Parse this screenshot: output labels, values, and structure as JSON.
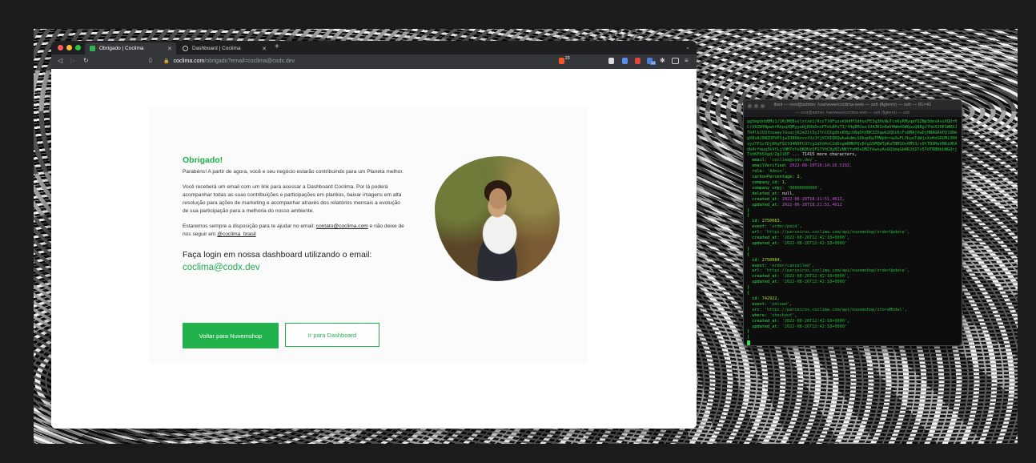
{
  "browser": {
    "tabs": [
      {
        "title": "Obrigado | Coclima",
        "active": true
      },
      {
        "title": "Dashboard | Coclima",
        "active": false
      }
    ],
    "new_tab": "+",
    "url_host": "coclima.com",
    "url_path": "/obrigado?email=coclima@codx.dev",
    "brave_badge": "23",
    "ext_badge": "14"
  },
  "page": {
    "heading": "Obrigado!",
    "para1": "Parabéns! A partir de agora, você e seu negócio estarão contribuindo para um Planeta melhor.",
    "para2": "Você receberá um email com um link para acessar a Dashboard Coclima. Por lá poderá acompanhar todas as suas contribuições e participações em plantios, baixar imagens em alta resolução para ações de marketing e acompanhar através dos relatórios mensais a evolução de sua participação para a melhoria do nosso ambiente.",
    "para3_before": "Estaremos sempre a disposição para te ajudar no email: ",
    "contact_email": "contato@coclima.com",
    "para3_middle": " e não deixe de nos seguir em ",
    "instagram": "@coclima_brasil",
    "login_title": "Faça login em nossa dashboard utilizando o email:",
    "login_email": "coclima@codx.dev",
    "btn_primary": "Voltar para Nuvemshop",
    "btn_secondary": "Ir para Dashboard"
  },
  "colors": {
    "accent": "#22b24c"
  },
  "terminal": {
    "title": "lbeit — root@admin: /var/www/coclima-web — ssh (figterm) — ssh — 81×41",
    "subtitle": "— root@admin: /var/www/coclima-web — ssh (figterm) — ssh",
    "blob": "ggSmpdnbBMz1/1KcM6Bvvlxtxe1/KccTl6Fuzsk9nHfSdhuxFE3q3HvNuTcsKyRMyqaYQZNp3dexAvsXQUrHCrV6ZWYNpwhfRhpqXQMyyaNjEObDnsPTdtAPoT3/fHqEMJaxlU4JKIn6mYHWm4OWQuuQ8BgJ7hbXJ0ESWRXJTb4lbJQ3fnoaaylGswcjK2m31t9yJYnlQ1gdhxKHgcbNqDhVBK3ZXqwb2QDiRcFx8MAjUwDjHNAGRkPQl8RmgV8xAJ8NZUPVPSjwIO8OAsvvtVzJfjVC8IQRQwkwkdmLS0kqdGpTMWp8rnwXwFLYbyeTqWjsXzHoGRUMi30HxyzTP1zfDjRKqFQ2lQ4N9PCU7cg1dVd4vC2d6ngmRMKPQvBfgS5MQWTpKaTBM1Ov6MV3/x0tTBXMaVBRi0KAdb4rfmuq3kVfLjlHH7nYnQK8UzQFS7YhC8yBZzNKYfoHOvQMZfkwnyAsGQSmqGb4RJd1Tv5TdTBBNkbNGQrjTshKFb5Xgd/ZgJiEP",
    "more": " ... 71415 more characters,",
    "lines": [
      [
        {
          "t": "  email: ",
          "c": "key"
        },
        {
          "t": "'coclima@codx.dev'",
          "c": "str"
        },
        {
          "t": ",",
          "c": "key"
        }
      ],
      [
        {
          "t": "  emailVerified: ",
          "c": "key"
        },
        {
          "t": "2022-08-10T16:14:20.519Z",
          "c": "date"
        },
        {
          "t": ",",
          "c": "key"
        }
      ],
      [
        {
          "t": "  role: ",
          "c": "key"
        },
        {
          "t": "'Admin'",
          "c": "str"
        },
        {
          "t": ",",
          "c": "key"
        }
      ],
      [
        {
          "t": "  carbonPercentage: ",
          "c": "key"
        },
        {
          "t": "2",
          "c": "num"
        },
        {
          "t": ",",
          "c": "key"
        }
      ],
      [
        {
          "t": "  company_id: ",
          "c": "key"
        },
        {
          "t": "1",
          "c": "num"
        },
        {
          "t": ",",
          "c": "key"
        }
      ],
      [
        {
          "t": "  company_cnpj: ",
          "c": "key"
        },
        {
          "t": "'00000000000'",
          "c": "str"
        },
        {
          "t": ",",
          "c": "key"
        }
      ],
      [
        {
          "t": "  deleted_at: ",
          "c": "key"
        },
        {
          "t": "null",
          "c": "white"
        },
        {
          "t": ",",
          "c": "key"
        }
      ],
      [
        {
          "t": "  created_at: ",
          "c": "key"
        },
        {
          "t": "2022-06-28T18:21:51.461Z",
          "c": "date"
        },
        {
          "t": ",",
          "c": "key"
        }
      ],
      [
        {
          "t": "  updated_at: ",
          "c": "key"
        },
        {
          "t": "2022-06-28T18:21:51.461Z",
          "c": "date"
        }
      ],
      [
        {
          "t": "}",
          "c": "key"
        }
      ],
      [
        {
          "t": "{",
          "c": "key"
        }
      ],
      [
        {
          "t": "  id: ",
          "c": "key"
        },
        {
          "t": "2750083",
          "c": "num"
        },
        {
          "t": ",",
          "c": "key"
        }
      ],
      [
        {
          "t": "  event: ",
          "c": "key"
        },
        {
          "t": "'order/paid'",
          "c": "str"
        },
        {
          "t": ",",
          "c": "key"
        }
      ],
      [
        {
          "t": "  url: ",
          "c": "key"
        },
        {
          "t": "'https://parceiros.coclima.com/api/nuvemshop/orderUpdate'",
          "c": "str"
        },
        {
          "t": ",",
          "c": "key"
        }
      ],
      [
        {
          "t": "  created_at: ",
          "c": "key"
        },
        {
          "t": "'2022-08-26T12:42:18+0000'",
          "c": "str"
        },
        {
          "t": ",",
          "c": "key"
        }
      ],
      [
        {
          "t": "  updated_at: ",
          "c": "key"
        },
        {
          "t": "'2022-08-26T12:42:18+0000'",
          "c": "str"
        }
      ],
      [
        {
          "t": "}",
          "c": "key"
        }
      ],
      [
        {
          "t": "{",
          "c": "key"
        }
      ],
      [
        {
          "t": "  id: ",
          "c": "key"
        },
        {
          "t": "2750084",
          "c": "num"
        },
        {
          "t": ",",
          "c": "key"
        }
      ],
      [
        {
          "t": "  event: ",
          "c": "key"
        },
        {
          "t": "'order/cancelled'",
          "c": "str"
        },
        {
          "t": ",",
          "c": "key"
        }
      ],
      [
        {
          "t": "  url: ",
          "c": "key"
        },
        {
          "t": "'https://parceiros.coclima.com/api/nuvemshop/orderUpdate'",
          "c": "str"
        },
        {
          "t": ",",
          "c": "key"
        }
      ],
      [
        {
          "t": "  created_at: ",
          "c": "key"
        },
        {
          "t": "'2022-08-26T12:42:18+0000'",
          "c": "str"
        },
        {
          "t": ",",
          "c": "key"
        }
      ],
      [
        {
          "t": "  updated_at: ",
          "c": "key"
        },
        {
          "t": "'2022-08-26T12:42:18+0000'",
          "c": "str"
        }
      ],
      [
        {
          "t": "}",
          "c": "key"
        }
      ],
      [
        {
          "t": "{",
          "c": "key"
        }
      ],
      [
        {
          "t": "  id: ",
          "c": "key"
        },
        {
          "t": "742922",
          "c": "num"
        },
        {
          "t": ",",
          "c": "key"
        }
      ],
      [
        {
          "t": "  event: ",
          "c": "key"
        },
        {
          "t": "'onload'",
          "c": "str"
        },
        {
          "t": ",",
          "c": "key"
        }
      ],
      [
        {
          "t": "  src: ",
          "c": "key"
        },
        {
          "t": "'https://parceiros.coclima.com/api/nuvemshop/storeModal'",
          "c": "str"
        },
        {
          "t": ",",
          "c": "key"
        }
      ],
      [
        {
          "t": "  where: ",
          "c": "key"
        },
        {
          "t": "'checkout'",
          "c": "str"
        },
        {
          "t": ",",
          "c": "key"
        }
      ],
      [
        {
          "t": "  created_at: ",
          "c": "key"
        },
        {
          "t": "'2022-08-26T12:42:18+0000'",
          "c": "str"
        },
        {
          "t": ",",
          "c": "key"
        }
      ],
      [
        {
          "t": "  updated_at: ",
          "c": "key"
        },
        {
          "t": "'2022-08-26T12:42:18+0000'",
          "c": "str"
        }
      ],
      [
        {
          "t": "}",
          "c": "key"
        }
      ],
      [
        {
          "t": "]",
          "c": "key"
        }
      ]
    ]
  }
}
